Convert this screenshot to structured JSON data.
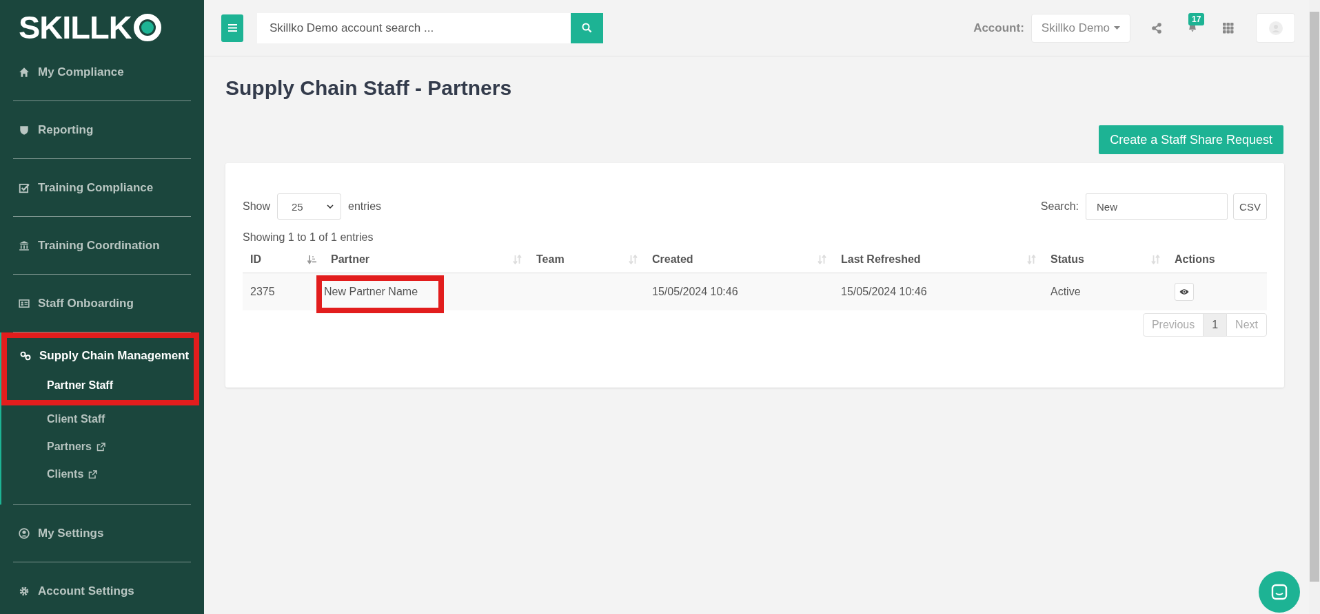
{
  "sidebar": {
    "logo": "SKILLK",
    "items": [
      {
        "label": "My Compliance",
        "expanded": false,
        "highlighted": false
      },
      {
        "label": "Reporting",
        "expanded": false,
        "highlighted": false
      },
      {
        "label": "Training Compliance",
        "expanded": false,
        "highlighted": false
      },
      {
        "label": "Training Coordination",
        "expanded": false,
        "highlighted": false
      },
      {
        "label": "Staff Onboarding",
        "expanded": false,
        "highlighted": false
      },
      {
        "label": "Supply Chain Management",
        "expanded": true,
        "highlighted": true,
        "children": [
          {
            "label": "Partner Staff",
            "selected": true,
            "external": false,
            "highlighted": true
          },
          {
            "label": "Client Staff",
            "selected": false,
            "external": false,
            "highlighted": false
          },
          {
            "label": "Partners",
            "selected": false,
            "external": true,
            "highlighted": false
          },
          {
            "label": "Clients",
            "selected": false,
            "external": true,
            "highlighted": false
          }
        ]
      },
      {
        "label": "My Settings",
        "expanded": false,
        "highlighted": false
      },
      {
        "label": "Account Settings",
        "expanded": false,
        "highlighted": false
      }
    ]
  },
  "topbar": {
    "search": {
      "placeholder": "Skillko Demo account search ..."
    },
    "account_label": "Account:",
    "account": "Skillko Demo",
    "notifications": "17"
  },
  "page": {
    "title": "Supply Chain Staff - Partners",
    "create_button": "Create a Staff Share Request"
  },
  "table": {
    "show_label": "Show",
    "page_size": "25",
    "entries_label": "entries",
    "search_label": "Search:",
    "search_value": "New",
    "csv_button": "CSV",
    "info": "Showing 1 to 1 of 1 entries",
    "columns": [
      {
        "label": "ID",
        "sortable": true,
        "sorted": true
      },
      {
        "label": "Partner",
        "sortable": true,
        "sorted": false
      },
      {
        "label": "Team",
        "sortable": true,
        "sorted": false
      },
      {
        "label": "Created",
        "sortable": true,
        "sorted": false
      },
      {
        "label": "Last Refreshed",
        "sortable": true,
        "sorted": false
      },
      {
        "label": "Status",
        "sortable": true,
        "sorted": false
      },
      {
        "label": "Actions",
        "sortable": false,
        "sorted": false
      }
    ],
    "rows": [
      {
        "cells": [
          {
            "text": "2375",
            "highlighted": false
          },
          {
            "text": "New Partner Name",
            "highlighted": true
          },
          {
            "text": "",
            "highlighted": false
          },
          {
            "text": "15/05/2024 10:46",
            "highlighted": false
          },
          {
            "text": "15/05/2024 10:46",
            "highlighted": false
          },
          {
            "text": "Active",
            "highlighted": false
          }
        ]
      }
    ],
    "pagination": [
      {
        "label": "Previous",
        "selected": false,
        "disabled": true
      },
      {
        "label": "1",
        "selected": true,
        "disabled": false
      },
      {
        "label": "Next",
        "selected": false,
        "disabled": true
      }
    ]
  }
}
